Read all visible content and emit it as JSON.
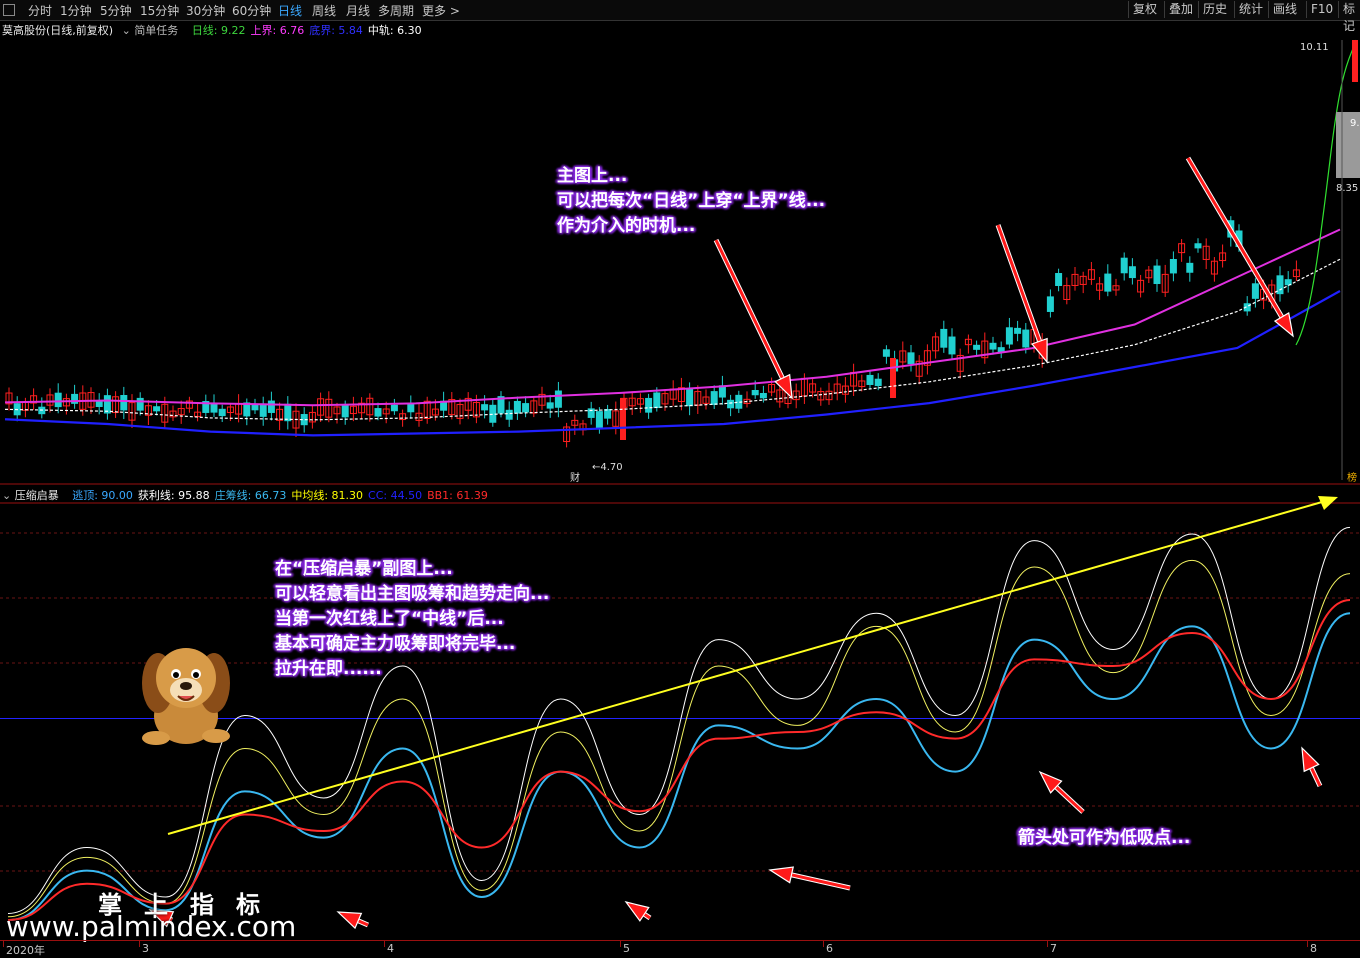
{
  "toolbar": {
    "timeframes": [
      "分时",
      "1分钟",
      "5分钟",
      "15分钟",
      "30分钟",
      "60分钟",
      "日线",
      "周线",
      "月线",
      "多周期",
      "更多 >"
    ],
    "active": "日线",
    "right_buttons": [
      "复权",
      "叠加",
      "历史",
      "统计",
      "画线",
      "F10",
      "标记"
    ]
  },
  "main_legend": {
    "stock": "莫高股份(日线,前复权)",
    "template": "简单任务",
    "items": [
      {
        "label": "日线: ",
        "value": "9.22",
        "color": "#3dd63d"
      },
      {
        "label": "上界: ",
        "value": "6.76",
        "color": "#ff3cff"
      },
      {
        "label": "底界: ",
        "value": "5.84",
        "color": "#3030ff"
      },
      {
        "label": "中轨: ",
        "value": "6.30",
        "color": "#ffffff"
      }
    ]
  },
  "price_labels": {
    "high": "10.11",
    "mid": "9.",
    "right_low": "8.35",
    "low": "4.70",
    "fin_mark": "财",
    "bang_mark": "榜"
  },
  "sub_legend": {
    "name": "压缩启暴",
    "items": [
      {
        "label": "逃顶: ",
        "value": "90.00",
        "color": "#3aa8ff"
      },
      {
        "label": "获利线: ",
        "value": "95.88",
        "color": "#ffffff"
      },
      {
        "label": "庄筹线: ",
        "value": "66.73",
        "color": "#3ab8f0"
      },
      {
        "label": "中均线: ",
        "value": "81.30",
        "color": "#ffff00"
      },
      {
        "label": "CC: ",
        "value": "44.50",
        "color": "#2222ff"
      },
      {
        "label": "BB1: ",
        "value": "61.39",
        "color": "#ff2a2a"
      }
    ]
  },
  "callouts": {
    "main": [
      "主图上...",
      "可以把每次“日线”上穿“上界”线...",
      "作为介入的时机..."
    ],
    "sub": [
      "在“压缩启暴”副图上...",
      "可以轻意看出主图吸筹和趋势走向...",
      "当第一次红线上了“中线”后...",
      "基本可确定主力吸筹即将完毕...",
      "拉升在即......"
    ],
    "arrows": [
      "箭头处可作为低吸点..."
    ]
  },
  "watermark": {
    "title": "掌上指标",
    "url": "www.palmindex.com"
  },
  "x_axis": [
    "2020年",
    "3",
    "4",
    "5",
    "6",
    "7",
    "8"
  ],
  "colors": {
    "up": "#ff2020",
    "down": "#20d0d0",
    "upper": "#e030e0",
    "lower": "#2020ff",
    "middle": "#ffffff",
    "daily": "#30e030"
  },
  "chart_data": [
    {
      "type": "line",
      "title": "莫高股份(日线,前复权)",
      "series": [
        {
          "name": "上界",
          "values": [
            6.28,
            6.3,
            6.27,
            6.25,
            6.27,
            6.33,
            6.38,
            6.45,
            6.55,
            6.7,
            6.85,
            7.1,
            7.6,
            8.1
          ]
        },
        {
          "name": "底界",
          "values": [
            6.25,
            6.2,
            6.12,
            6.08,
            6.1,
            6.12,
            6.16,
            6.2,
            6.3,
            6.42,
            6.6,
            6.8,
            7.0,
            7.6
          ]
        },
        {
          "name": "中轨",
          "values": [
            6.27,
            6.25,
            6.18,
            6.16,
            6.18,
            6.23,
            6.27,
            6.33,
            6.43,
            6.56,
            6.73,
            6.95,
            7.3,
            7.85
          ]
        }
      ],
      "price_marks": {
        "high": 10.11,
        "low": 4.7
      }
    },
    {
      "type": "line",
      "title": "压缩启暴",
      "x": [
        "2020年",
        "3",
        "4",
        "5",
        "6",
        "7",
        "8"
      ],
      "series": [
        {
          "name": "获利线",
          "values": [
            5,
            25,
            10,
            65,
            40,
            80,
            15,
            70,
            35,
            88,
            70,
            96,
            65,
            118,
            85,
            120,
            70,
            122
          ]
        },
        {
          "name": "中均线",
          "values": [
            4,
            22,
            8,
            55,
            35,
            70,
            12,
            60,
            30,
            80,
            62,
            92,
            60,
            110,
            78,
            112,
            65,
            108
          ]
        },
        {
          "name": "庄筹线",
          "values": [
            3,
            18,
            6,
            42,
            28,
            55,
            10,
            48,
            25,
            62,
            55,
            70,
            48,
            88,
            70,
            92,
            55,
            96
          ]
        },
        {
          "name": "BB1",
          "values": [
            3,
            14,
            8,
            35,
            30,
            45,
            25,
            48,
            36,
            58,
            60,
            66,
            58,
            82,
            80,
            90,
            70,
            100
          ]
        }
      ],
      "reference_lines": {
        "逃顶": 90.0,
        "CC": 44.5
      }
    }
  ]
}
